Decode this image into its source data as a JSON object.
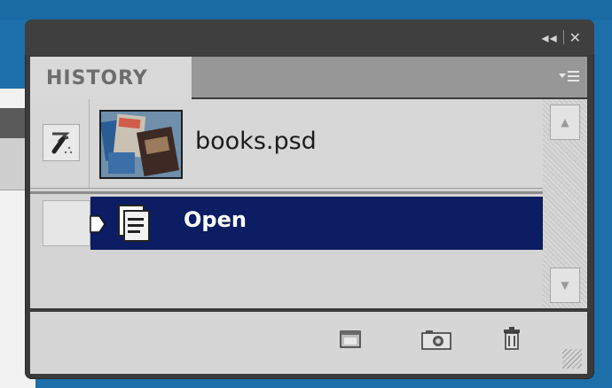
{
  "panel": {
    "titlebar": {
      "collapse_glyph": "◂◂",
      "close_glyph": "✕"
    },
    "tab": {
      "label": "HISTORY"
    },
    "menu_icon": "panel-menu-icon"
  },
  "snapshot": {
    "name": "books.psd"
  },
  "states": [
    {
      "label": "Open",
      "selected": true
    }
  ],
  "colors": {
    "selection": "#0c1d63",
    "panel_bg": "#d4d4d4",
    "desktop": "#1d6fa9"
  },
  "footer": {
    "buttons": [
      "new-document-from-state-icon",
      "create-snapshot-icon",
      "delete-state-icon"
    ]
  }
}
